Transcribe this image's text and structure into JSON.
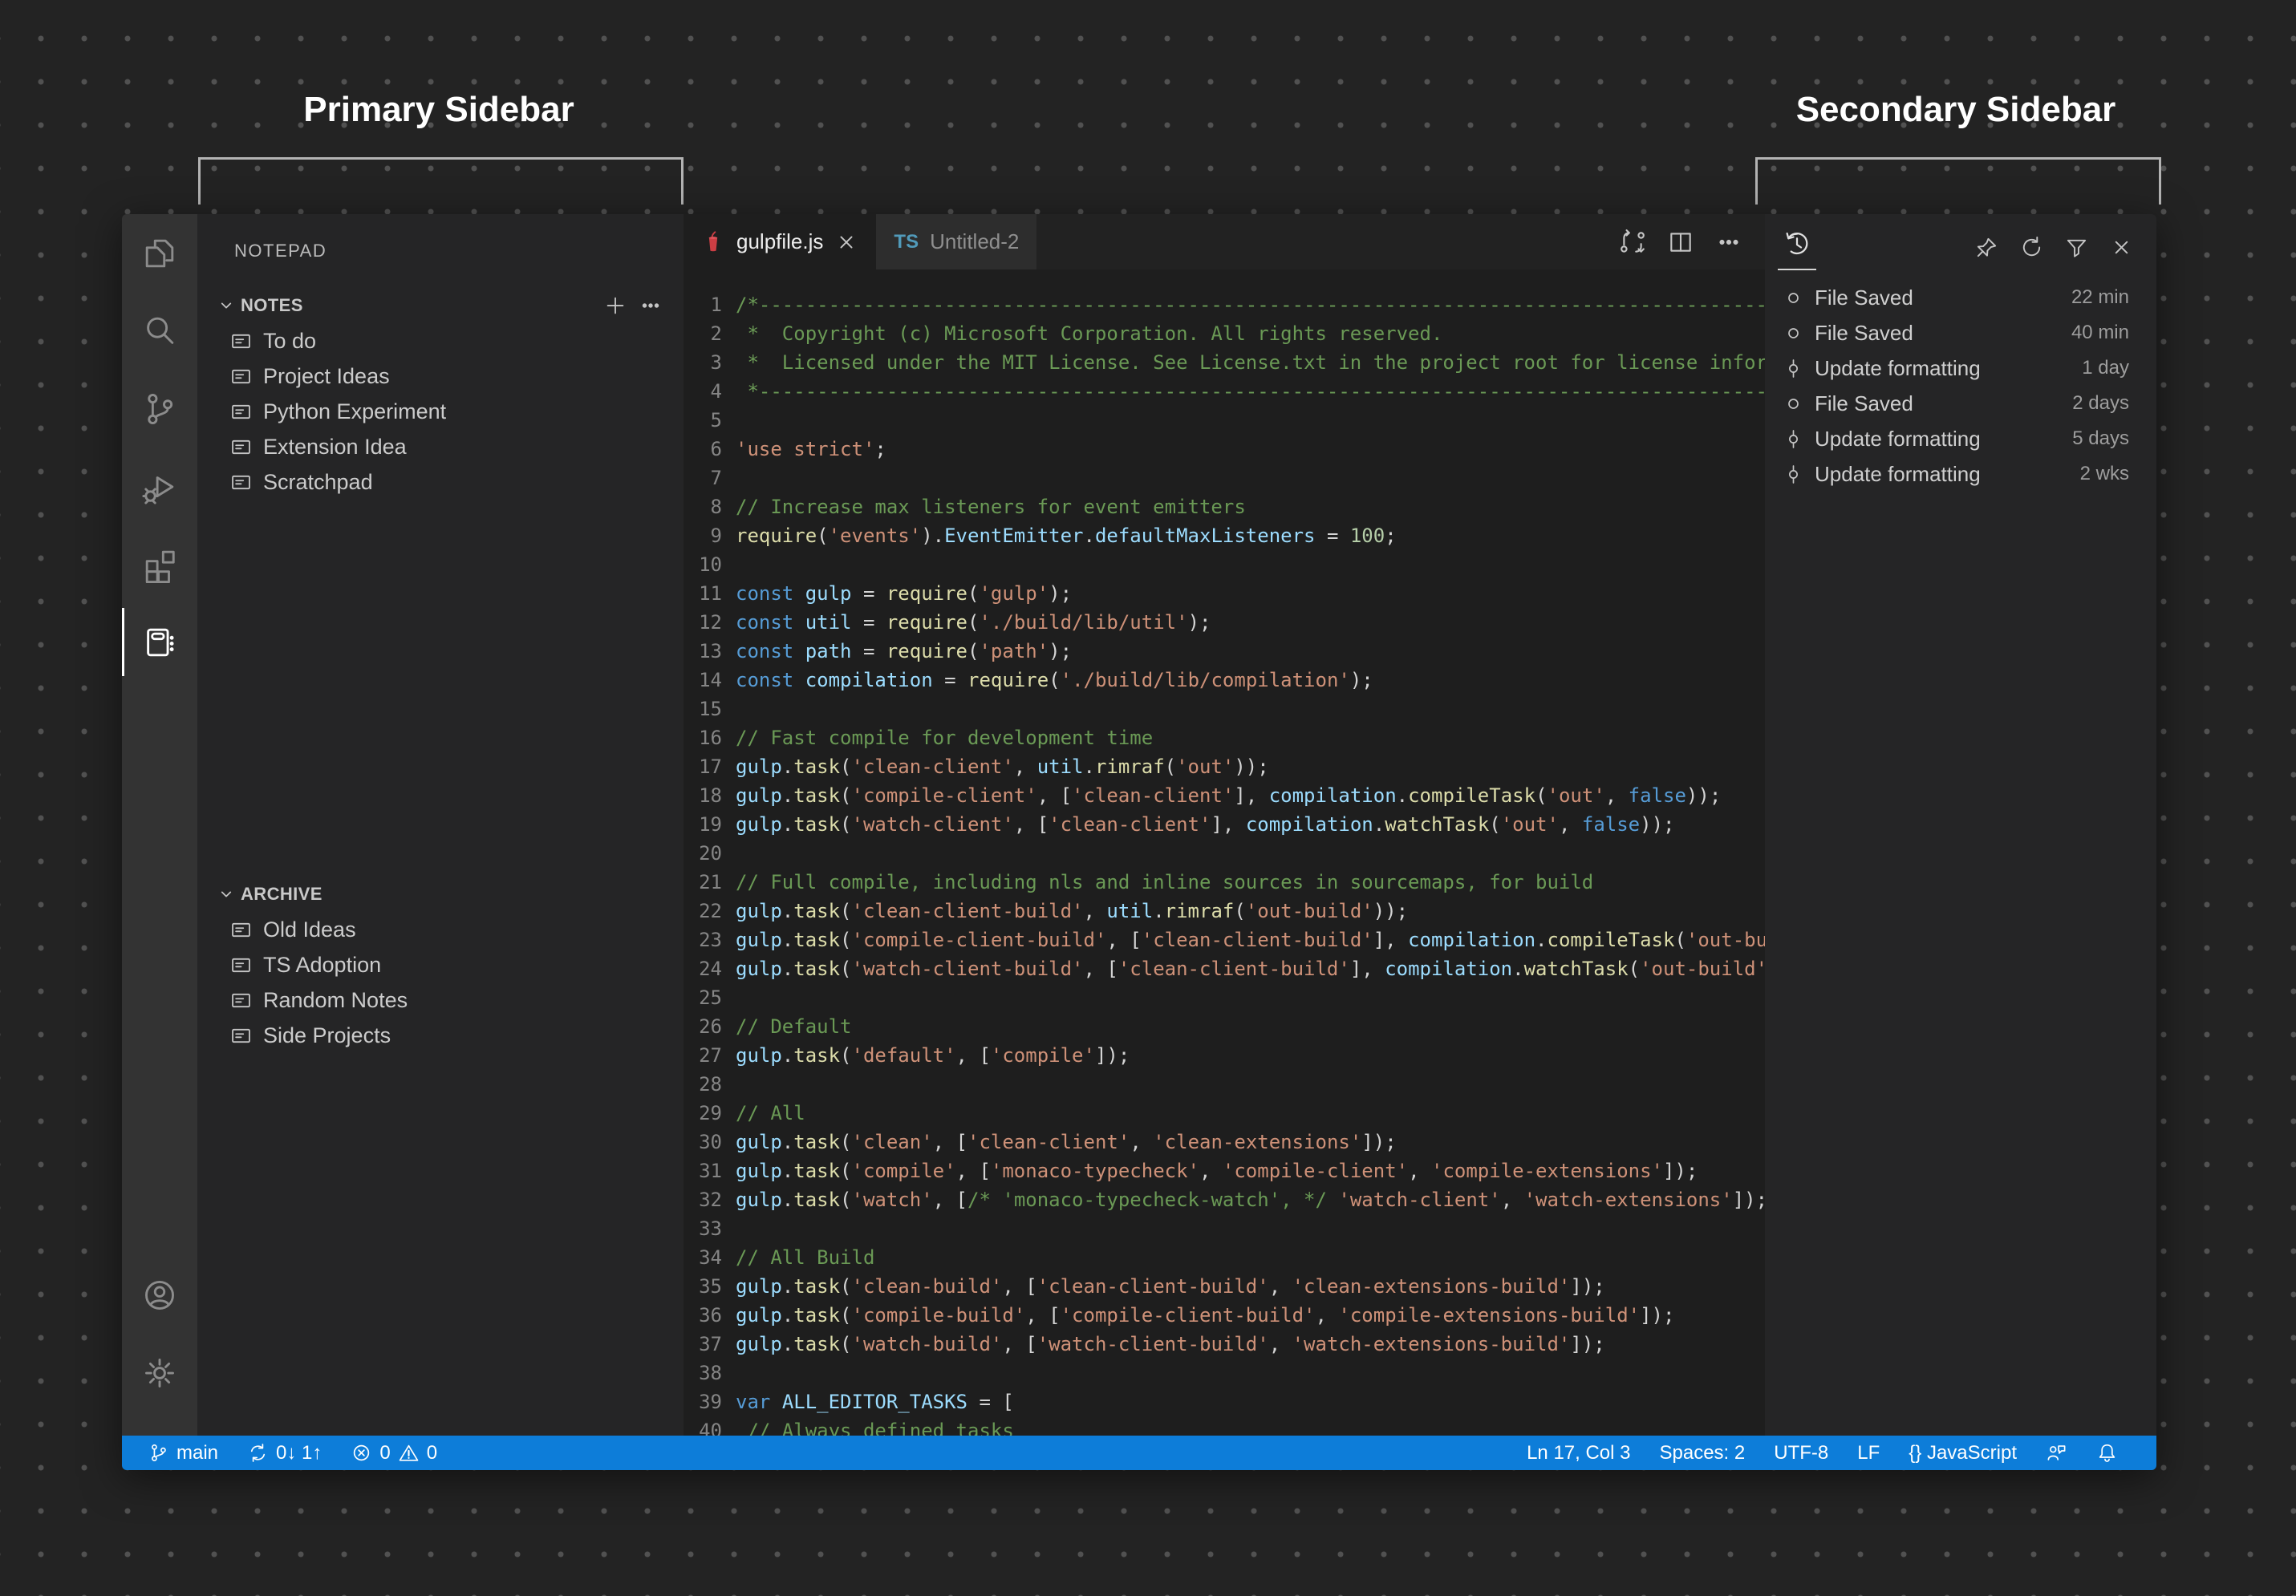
{
  "annotations": {
    "primary_label": "Primary Sidebar",
    "secondary_label": "Secondary Sidebar"
  },
  "colors": {
    "status_bar": "#0d7dd9",
    "gulp_red": "#cc3e44",
    "ts_blue": "#519aba",
    "editor_bg": "#1e1e1e",
    "sidebar_bg": "#252526",
    "activity_bar_bg": "#333333"
  },
  "activity_bar": {
    "items": [
      {
        "name": "explorer",
        "icon": "files",
        "active": false
      },
      {
        "name": "search",
        "icon": "search",
        "active": false
      },
      {
        "name": "source-control",
        "icon": "source-control",
        "active": false
      },
      {
        "name": "run-debug",
        "icon": "debug",
        "active": false
      },
      {
        "name": "extensions",
        "icon": "extensions",
        "active": false
      },
      {
        "name": "notepad",
        "icon": "notepad",
        "active": true
      }
    ],
    "bottom": [
      {
        "name": "account",
        "icon": "account"
      },
      {
        "name": "settings",
        "icon": "gear"
      }
    ]
  },
  "sidebar": {
    "title": "NOTEPAD",
    "title_action_icon": "more",
    "sections": [
      {
        "label": "NOTES",
        "actions": [
          "plus",
          "more"
        ],
        "items": [
          "To do",
          "Project Ideas",
          "Python Experiment",
          "Extension Idea",
          "Scratchpad"
        ]
      },
      {
        "label": "ARCHIVE",
        "actions": [],
        "items": [
          "Old Ideas",
          "TS Adoption",
          "Random Notes",
          "Side Projects"
        ]
      }
    ]
  },
  "tabs": [
    {
      "label": "gulpfile.js",
      "icon": "gulp",
      "active": true,
      "close": true
    },
    {
      "label": "Untitled-2",
      "icon": "ts",
      "active": false,
      "close": false
    }
  ],
  "editor_actions": [
    {
      "name": "open-changes",
      "icon": "compare"
    },
    {
      "name": "split-editor",
      "icon": "split"
    },
    {
      "name": "more-actions",
      "icon": "more"
    }
  ],
  "editor": {
    "language": "javascript",
    "lines": [
      [
        [
          "cm",
          "/*---------------------------------------------------------------------------------------------"
        ]
      ],
      [
        [
          "cm",
          " *  Copyright (c) Microsoft Corporation. All rights reserved."
        ]
      ],
      [
        [
          "cm",
          " *  Licensed under the MIT License. See License.txt in the project root for license information."
        ]
      ],
      [
        [
          "cm",
          " *--------------------------------------------------------------------------------------------*/"
        ]
      ],
      [],
      [
        [
          "st",
          "'use strict'"
        ],
        [
          "pl",
          ";"
        ]
      ],
      [],
      [
        [
          "cm",
          "// Increase max listeners for event emitters"
        ]
      ],
      [
        [
          "fn",
          "require"
        ],
        [
          "pl",
          "("
        ],
        [
          "st",
          "'events'"
        ],
        [
          "pl",
          ")."
        ],
        [
          "vr",
          "EventEmitter"
        ],
        [
          "pl",
          "."
        ],
        [
          "vr",
          "defaultMaxListeners"
        ],
        [
          "pl",
          " = "
        ],
        [
          "nu",
          "100"
        ],
        [
          "pl",
          ";"
        ]
      ],
      [],
      [
        [
          "kw",
          "const"
        ],
        [
          "pl",
          " "
        ],
        [
          "vr",
          "gulp"
        ],
        [
          "pl",
          " = "
        ],
        [
          "fn",
          "require"
        ],
        [
          "pl",
          "("
        ],
        [
          "st",
          "'gulp'"
        ],
        [
          "pl",
          ");"
        ]
      ],
      [
        [
          "kw",
          "const"
        ],
        [
          "pl",
          " "
        ],
        [
          "vr",
          "util"
        ],
        [
          "pl",
          " = "
        ],
        [
          "fn",
          "require"
        ],
        [
          "pl",
          "("
        ],
        [
          "st",
          "'./build/lib/util'"
        ],
        [
          "pl",
          ");"
        ]
      ],
      [
        [
          "kw",
          "const"
        ],
        [
          "pl",
          " "
        ],
        [
          "vr",
          "path"
        ],
        [
          "pl",
          " = "
        ],
        [
          "fn",
          "require"
        ],
        [
          "pl",
          "("
        ],
        [
          "st",
          "'path'"
        ],
        [
          "pl",
          ");"
        ]
      ],
      [
        [
          "kw",
          "const"
        ],
        [
          "pl",
          " "
        ],
        [
          "vr",
          "compilation"
        ],
        [
          "pl",
          " = "
        ],
        [
          "fn",
          "require"
        ],
        [
          "pl",
          "("
        ],
        [
          "st",
          "'./build/lib/compilation'"
        ],
        [
          "pl",
          ");"
        ]
      ],
      [],
      [
        [
          "cm",
          "// Fast compile for development time"
        ]
      ],
      [
        [
          "vr",
          "gulp"
        ],
        [
          "pl",
          "."
        ],
        [
          "fn",
          "task"
        ],
        [
          "pl",
          "("
        ],
        [
          "st",
          "'clean-client'"
        ],
        [
          "pl",
          ", "
        ],
        [
          "vr",
          "util"
        ],
        [
          "pl",
          "."
        ],
        [
          "fn",
          "rimraf"
        ],
        [
          "pl",
          "("
        ],
        [
          "st",
          "'out'"
        ],
        [
          "pl",
          "));"
        ]
      ],
      [
        [
          "vr",
          "gulp"
        ],
        [
          "pl",
          "."
        ],
        [
          "fn",
          "task"
        ],
        [
          "pl",
          "("
        ],
        [
          "st",
          "'compile-client'"
        ],
        [
          "pl",
          ", ["
        ],
        [
          "st",
          "'clean-client'"
        ],
        [
          "pl",
          "], "
        ],
        [
          "vr",
          "compilation"
        ],
        [
          "pl",
          "."
        ],
        [
          "fn",
          "compileTask"
        ],
        [
          "pl",
          "("
        ],
        [
          "st",
          "'out'"
        ],
        [
          "pl",
          ", "
        ],
        [
          "kw",
          "false"
        ],
        [
          "pl",
          "));"
        ]
      ],
      [
        [
          "vr",
          "gulp"
        ],
        [
          "pl",
          "."
        ],
        [
          "fn",
          "task"
        ],
        [
          "pl",
          "("
        ],
        [
          "st",
          "'watch-client'"
        ],
        [
          "pl",
          ", ["
        ],
        [
          "st",
          "'clean-client'"
        ],
        [
          "pl",
          "], "
        ],
        [
          "vr",
          "compilation"
        ],
        [
          "pl",
          "."
        ],
        [
          "fn",
          "watchTask"
        ],
        [
          "pl",
          "("
        ],
        [
          "st",
          "'out'"
        ],
        [
          "pl",
          ", "
        ],
        [
          "kw",
          "false"
        ],
        [
          "pl",
          "));"
        ]
      ],
      [],
      [
        [
          "cm",
          "// Full compile, including nls and inline sources in sourcemaps, for build"
        ]
      ],
      [
        [
          "vr",
          "gulp"
        ],
        [
          "pl",
          "."
        ],
        [
          "fn",
          "task"
        ],
        [
          "pl",
          "("
        ],
        [
          "st",
          "'clean-client-build'"
        ],
        [
          "pl",
          ", "
        ],
        [
          "vr",
          "util"
        ],
        [
          "pl",
          "."
        ],
        [
          "fn",
          "rimraf"
        ],
        [
          "pl",
          "("
        ],
        [
          "st",
          "'out-build'"
        ],
        [
          "pl",
          "));"
        ]
      ],
      [
        [
          "vr",
          "gulp"
        ],
        [
          "pl",
          "."
        ],
        [
          "fn",
          "task"
        ],
        [
          "pl",
          "("
        ],
        [
          "st",
          "'compile-client-build'"
        ],
        [
          "pl",
          ", ["
        ],
        [
          "st",
          "'clean-client-build'"
        ],
        [
          "pl",
          "], "
        ],
        [
          "vr",
          "compilation"
        ],
        [
          "pl",
          "."
        ],
        [
          "fn",
          "compileTask"
        ],
        [
          "pl",
          "("
        ],
        [
          "st",
          "'out-build'"
        ],
        [
          "pl",
          ", "
        ],
        [
          "kw",
          "true"
        ],
        [
          "pl",
          "));"
        ]
      ],
      [
        [
          "vr",
          "gulp"
        ],
        [
          "pl",
          "."
        ],
        [
          "fn",
          "task"
        ],
        [
          "pl",
          "("
        ],
        [
          "st",
          "'watch-client-build'"
        ],
        [
          "pl",
          ", ["
        ],
        [
          "st",
          "'clean-client-build'"
        ],
        [
          "pl",
          "], "
        ],
        [
          "vr",
          "compilation"
        ],
        [
          "pl",
          "."
        ],
        [
          "fn",
          "watchTask"
        ],
        [
          "pl",
          "("
        ],
        [
          "st",
          "'out-build'"
        ],
        [
          "pl",
          ", "
        ],
        [
          "kw",
          "true"
        ],
        [
          "pl",
          "));"
        ]
      ],
      [],
      [
        [
          "cm",
          "// Default"
        ]
      ],
      [
        [
          "vr",
          "gulp"
        ],
        [
          "pl",
          "."
        ],
        [
          "fn",
          "task"
        ],
        [
          "pl",
          "("
        ],
        [
          "st",
          "'default'"
        ],
        [
          "pl",
          ", ["
        ],
        [
          "st",
          "'compile'"
        ],
        [
          "pl",
          "]);"
        ]
      ],
      [],
      [
        [
          "cm",
          "// All"
        ]
      ],
      [
        [
          "vr",
          "gulp"
        ],
        [
          "pl",
          "."
        ],
        [
          "fn",
          "task"
        ],
        [
          "pl",
          "("
        ],
        [
          "st",
          "'clean'"
        ],
        [
          "pl",
          ", ["
        ],
        [
          "st",
          "'clean-client'"
        ],
        [
          "pl",
          ", "
        ],
        [
          "st",
          "'clean-extensions'"
        ],
        [
          "pl",
          "]);"
        ]
      ],
      [
        [
          "vr",
          "gulp"
        ],
        [
          "pl",
          "."
        ],
        [
          "fn",
          "task"
        ],
        [
          "pl",
          "("
        ],
        [
          "st",
          "'compile'"
        ],
        [
          "pl",
          ", ["
        ],
        [
          "st",
          "'monaco-typecheck'"
        ],
        [
          "pl",
          ", "
        ],
        [
          "st",
          "'compile-client'"
        ],
        [
          "pl",
          ", "
        ],
        [
          "st",
          "'compile-extensions'"
        ],
        [
          "pl",
          "]);"
        ]
      ],
      [
        [
          "vr",
          "gulp"
        ],
        [
          "pl",
          "."
        ],
        [
          "fn",
          "task"
        ],
        [
          "pl",
          "("
        ],
        [
          "st",
          "'watch'"
        ],
        [
          "pl",
          ", ["
        ],
        [
          "cm",
          "/* 'monaco-typecheck-watch', */"
        ],
        [
          "pl",
          " "
        ],
        [
          "st",
          "'watch-client'"
        ],
        [
          "pl",
          ", "
        ],
        [
          "st",
          "'watch-extensions'"
        ],
        [
          "pl",
          "]);"
        ]
      ],
      [],
      [
        [
          "cm",
          "// All Build"
        ]
      ],
      [
        [
          "vr",
          "gulp"
        ],
        [
          "pl",
          "."
        ],
        [
          "fn",
          "task"
        ],
        [
          "pl",
          "("
        ],
        [
          "st",
          "'clean-build'"
        ],
        [
          "pl",
          ", ["
        ],
        [
          "st",
          "'clean-client-build'"
        ],
        [
          "pl",
          ", "
        ],
        [
          "st",
          "'clean-extensions-build'"
        ],
        [
          "pl",
          "]);"
        ]
      ],
      [
        [
          "vr",
          "gulp"
        ],
        [
          "pl",
          "."
        ],
        [
          "fn",
          "task"
        ],
        [
          "pl",
          "("
        ],
        [
          "st",
          "'compile-build'"
        ],
        [
          "pl",
          ", ["
        ],
        [
          "st",
          "'compile-client-build'"
        ],
        [
          "pl",
          ", "
        ],
        [
          "st",
          "'compile-extensions-build'"
        ],
        [
          "pl",
          "]);"
        ]
      ],
      [
        [
          "vr",
          "gulp"
        ],
        [
          "pl",
          "."
        ],
        [
          "fn",
          "task"
        ],
        [
          "pl",
          "("
        ],
        [
          "st",
          "'watch-build'"
        ],
        [
          "pl",
          ", ["
        ],
        [
          "st",
          "'watch-client-build'"
        ],
        [
          "pl",
          ", "
        ],
        [
          "st",
          "'watch-extensions-build'"
        ],
        [
          "pl",
          "]);"
        ]
      ],
      [],
      [
        [
          "kw",
          "var"
        ],
        [
          "pl",
          " "
        ],
        [
          "vr",
          "ALL_EDITOR_TASKS"
        ],
        [
          "pl",
          " = ["
        ]
      ],
      [
        [
          "pl",
          " "
        ],
        [
          "cm",
          "// Always defined tasks"
        ]
      ]
    ]
  },
  "timeline": {
    "view_icon": "history",
    "actions": [
      {
        "name": "pin",
        "icon": "pin"
      },
      {
        "name": "refresh",
        "icon": "refresh"
      },
      {
        "name": "filter",
        "icon": "filter"
      },
      {
        "name": "close",
        "icon": "close"
      }
    ],
    "items": [
      {
        "label": "File Saved",
        "time": "22 min",
        "icon": "save"
      },
      {
        "label": "File Saved",
        "time": "40 min",
        "icon": "save"
      },
      {
        "label": "Update formatting",
        "time": "1 day",
        "icon": "commit"
      },
      {
        "label": "File Saved",
        "time": "2 days",
        "icon": "save"
      },
      {
        "label": "Update formatting",
        "time": "5 days",
        "icon": "commit"
      },
      {
        "label": "Update formatting",
        "time": "2 wks",
        "icon": "commit"
      }
    ]
  },
  "status_bar": {
    "left": [
      {
        "name": "branch-status",
        "segs": [
          {
            "i": "branch"
          },
          {
            "t": "main"
          }
        ]
      },
      {
        "name": "sync-status",
        "segs": [
          {
            "i": "sync"
          },
          {
            "t": "0↓ 1↑"
          }
        ]
      },
      {
        "name": "problems-status",
        "segs": [
          {
            "i": "error"
          },
          {
            "t": "0"
          },
          {
            "i": "warning"
          },
          {
            "t": "0"
          }
        ]
      }
    ],
    "right": [
      {
        "name": "cursor-position",
        "segs": [
          {
            "t": "Ln 17, Col 3"
          }
        ]
      },
      {
        "name": "indentation",
        "segs": [
          {
            "t": "Spaces: 2"
          }
        ]
      },
      {
        "name": "encoding",
        "segs": [
          {
            "t": "UTF-8"
          }
        ]
      },
      {
        "name": "eol",
        "segs": [
          {
            "t": "LF"
          }
        ]
      },
      {
        "name": "language-mode",
        "segs": [
          {
            "t": "{} JavaScript"
          }
        ]
      },
      {
        "name": "feedback",
        "segs": [
          {
            "i": "feedback"
          }
        ]
      },
      {
        "name": "notifications",
        "segs": [
          {
            "i": "bell"
          }
        ]
      }
    ]
  }
}
